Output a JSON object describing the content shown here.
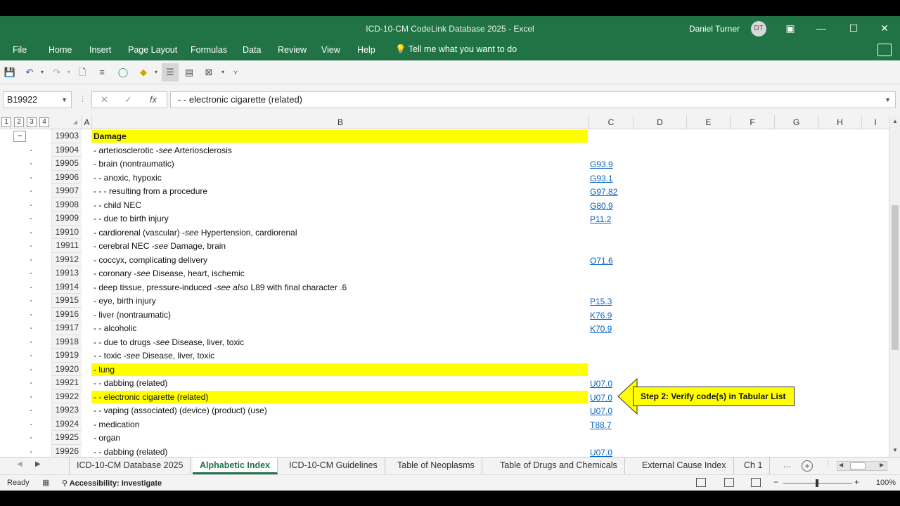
{
  "window": {
    "title": "ICD-10-CM CodeLink Database 2025  -  Excel",
    "user": "Daniel Turner",
    "user_initials": "DT"
  },
  "ribbon": {
    "tabs": [
      "File",
      "Home",
      "Insert",
      "Page Layout",
      "Formulas",
      "Data",
      "Review",
      "View",
      "Help"
    ],
    "tellme": "Tell me what you want to do"
  },
  "formula_bar": {
    "name_box": "B19922",
    "formula": "- - electronic cigarette (related)"
  },
  "outline_levels": [
    "1",
    "2",
    "3",
    "4"
  ],
  "columns": [
    "A",
    "B",
    "C",
    "D",
    "E",
    "F",
    "G",
    "H",
    "I"
  ],
  "rows": [
    {
      "num": "19903",
      "text": "Damage",
      "code": "",
      "hl": true,
      "bold": true
    },
    {
      "num": "19904",
      "text": "- arteriosclerotic -see Arteriosclerosis",
      "code": ""
    },
    {
      "num": "19905",
      "text": "- brain (nontraumatic)",
      "code": "G93.9"
    },
    {
      "num": "19906",
      "text": "- - anoxic, hypoxic",
      "code": "G93.1"
    },
    {
      "num": "19907",
      "text": "- - - resulting from a procedure",
      "code": "G97.82"
    },
    {
      "num": "19908",
      "text": "- - child NEC",
      "code": "G80.9"
    },
    {
      "num": "19909",
      "text": "- - due to birth injury",
      "code": "P11.2"
    },
    {
      "num": "19910",
      "text": "- cardiorenal (vascular) -see Hypertension, cardiorenal",
      "code": ""
    },
    {
      "num": "19911",
      "text": "- cerebral NEC -see Damage, brain",
      "code": ""
    },
    {
      "num": "19912",
      "text": "- coccyx, complicating delivery",
      "code": "O71.6"
    },
    {
      "num": "19913",
      "text": "- coronary -see Disease, heart, ischemic",
      "code": ""
    },
    {
      "num": "19914",
      "text": "- deep tissue, pressure-induced -see also L89 with final character .6",
      "code": ""
    },
    {
      "num": "19915",
      "text": "- eye, birth injury",
      "code": "P15.3"
    },
    {
      "num": "19916",
      "text": "- liver (nontraumatic)",
      "code": "K76.9"
    },
    {
      "num": "19917",
      "text": "- - alcoholic",
      "code": "K70.9"
    },
    {
      "num": "19918",
      "text": "- - due to drugs -see Disease, liver, toxic",
      "code": ""
    },
    {
      "num": "19919",
      "text": "- - toxic -see Disease, liver, toxic",
      "code": ""
    },
    {
      "num": "19920",
      "text": "- lung",
      "code": "",
      "hl": true
    },
    {
      "num": "19921",
      "text": "- - dabbing (related)",
      "code": "U07.0"
    },
    {
      "num": "19922",
      "text": "- - electronic cigarette (related)",
      "code": "U07.0",
      "hl": true
    },
    {
      "num": "19923",
      "text": "- - vaping (associated) (device) (product) (use)",
      "code": "U07.0"
    },
    {
      "num": "19924",
      "text": "- medication",
      "code": "T88.7"
    },
    {
      "num": "19925",
      "text": "- organ",
      "code": ""
    },
    {
      "num": "19926",
      "text": "- - dabbing (related)",
      "code": "U07.0"
    }
  ],
  "callout": "Step 2: Verify code(s) in Tabular List",
  "sheet_tabs": [
    "ICD-10-CM Database 2025",
    "Alphabetic Index",
    "ICD-10-CM Guidelines",
    "Table of Neoplasms",
    "Table of Drugs and Chemicals",
    "External Cause Index",
    "Ch 1"
  ],
  "active_sheet": "Alphabetic Index",
  "more_tabs": "...",
  "status": {
    "ready": "Ready",
    "accessibility": "Accessibility: Investigate",
    "zoom": "100%"
  }
}
